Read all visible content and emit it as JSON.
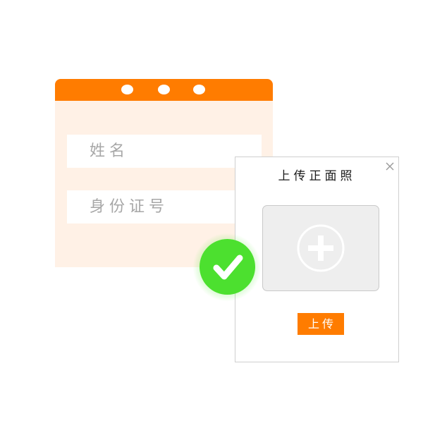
{
  "colors": {
    "accent": "#ff7c00",
    "form_background": "#fff1e6",
    "success": "#4ce02f",
    "dropzone": "#eeeeee"
  },
  "form": {
    "fields": [
      {
        "placeholder": "姓名"
      },
      {
        "placeholder": "身份证号"
      }
    ]
  },
  "dialog": {
    "title": "上传正面照",
    "close_icon": "close-icon",
    "dropzone_icon": "plus-circle-icon",
    "upload_button_label": "上传"
  },
  "badge": {
    "icon": "checkmark-icon"
  }
}
